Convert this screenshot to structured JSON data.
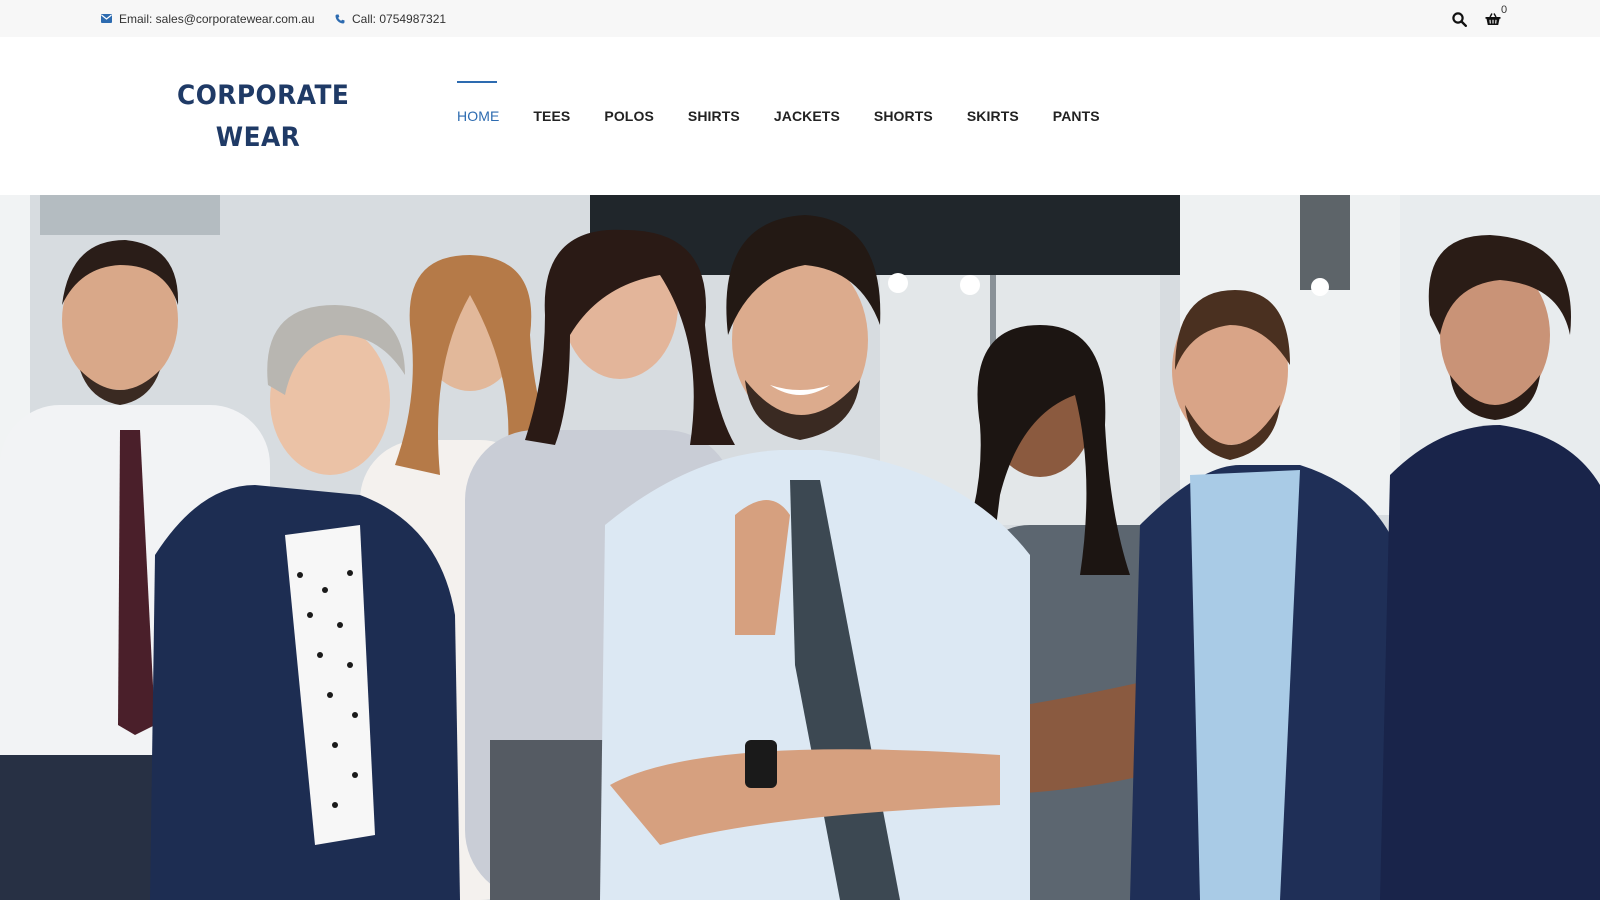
{
  "topbar": {
    "email_text": "Email: sales@corporatewear.com.au",
    "phone_text": "Call: 0754987321",
    "cart_count": "0",
    "icons": [
      "envelope-icon",
      "phone-icon",
      "search-icon",
      "cart-icon"
    ]
  },
  "header": {
    "logo_line1": "CORPORATE",
    "logo_line2": "WEAR",
    "nav": [
      {
        "label": "HOME",
        "active": true
      },
      {
        "label": "TEES",
        "active": false
      },
      {
        "label": "POLOS",
        "active": false
      },
      {
        "label": "SHIRTS",
        "active": false
      },
      {
        "label": "JACKETS",
        "active": false
      },
      {
        "label": "SHORTS",
        "active": false
      },
      {
        "label": "SKIRTS",
        "active": false
      },
      {
        "label": "PANTS",
        "active": false
      }
    ]
  },
  "colors": {
    "accent": "#2d6bb0",
    "logo": "#1f3a66",
    "topbar_bg": "#f7f7f7"
  }
}
